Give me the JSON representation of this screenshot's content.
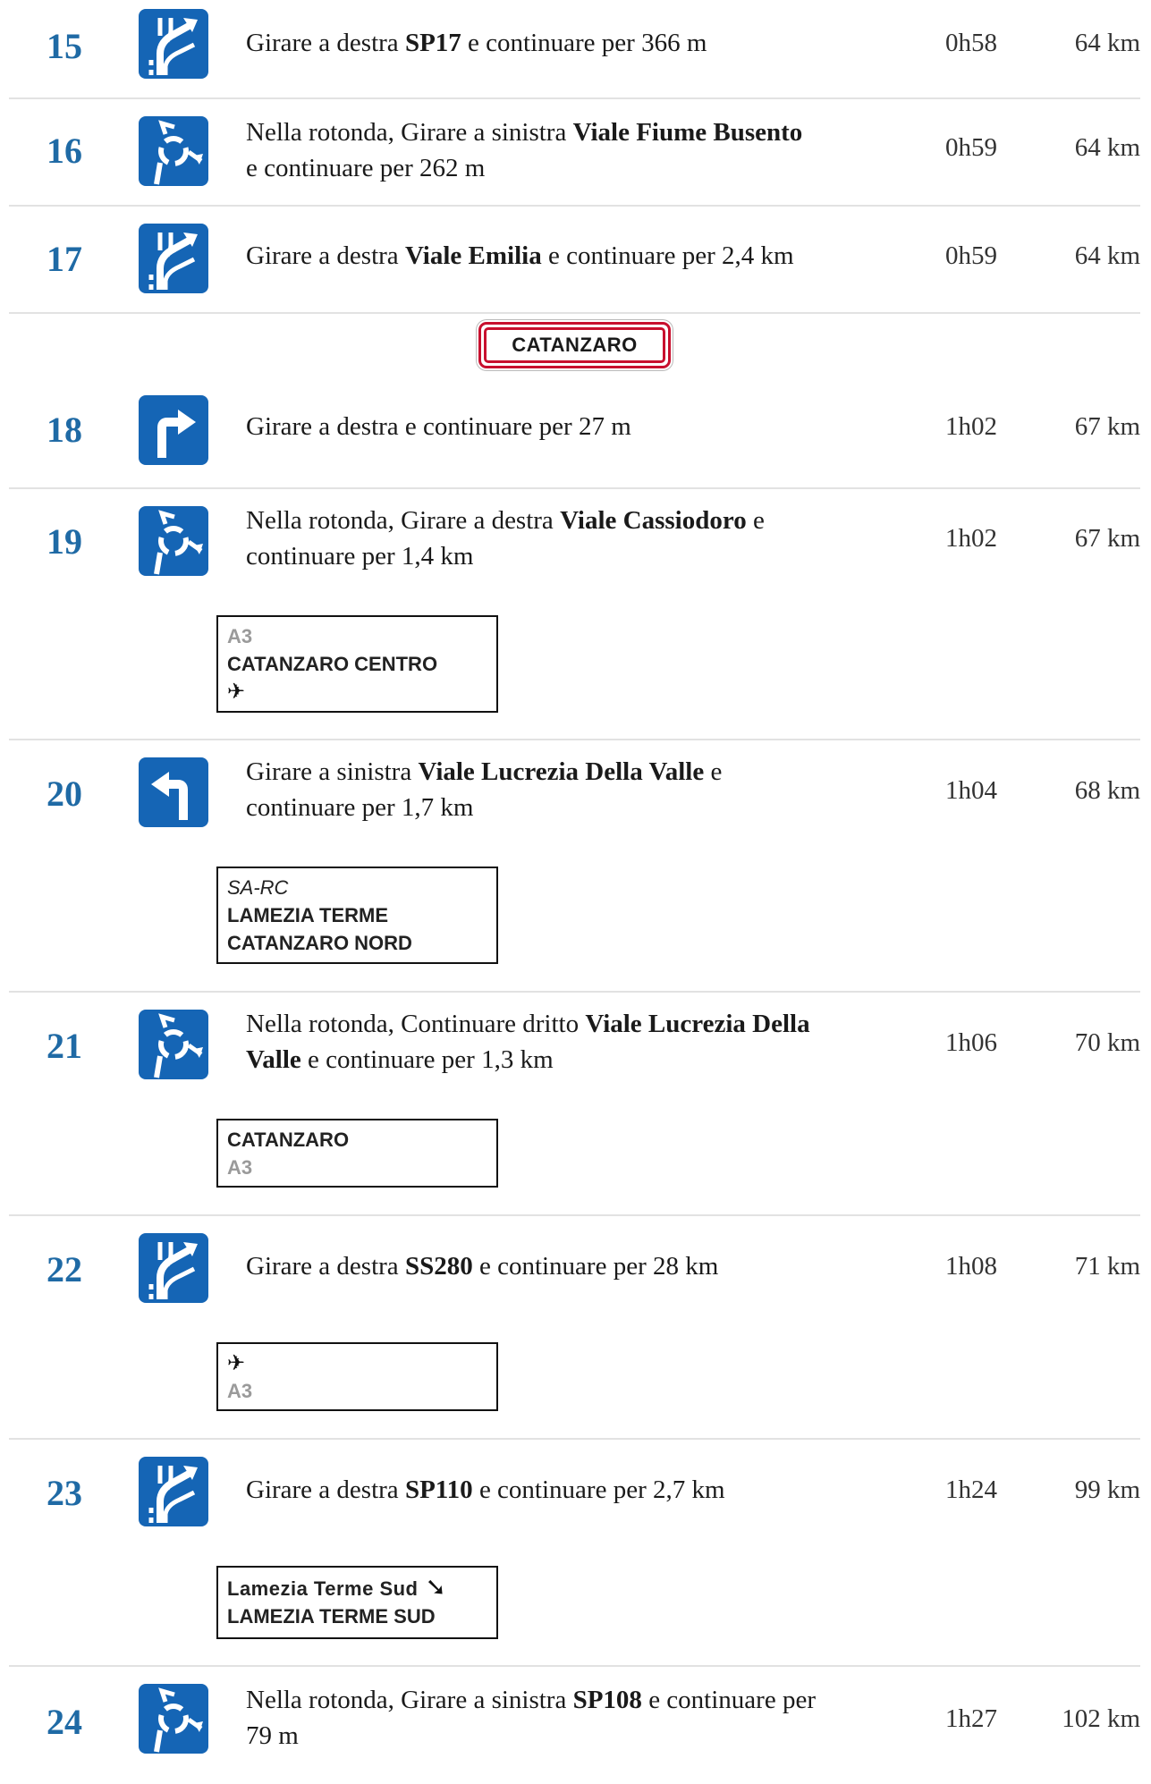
{
  "city_sign": "CATANZARO",
  "steps": [
    {
      "num": "15",
      "maneuver": "bear-right",
      "pre": "Girare a destra ",
      "road": "SP17",
      "post": " e continuare per 366 m",
      "time": "0h58",
      "dist": "64 km"
    },
    {
      "num": "16",
      "maneuver": "roundabout",
      "pre": "Nella rotonda, Girare a sinistra ",
      "road": "Viale Fiume Busento",
      "post": "e continuare per 262 m",
      "time": "0h59",
      "dist": "64 km"
    },
    {
      "num": "17",
      "maneuver": "bear-right",
      "pre": "Girare a destra ",
      "road": "Viale Emilia",
      "post": " e continuare per 2,4 km",
      "time": "0h59",
      "dist": "64 km"
    },
    {
      "num": "18",
      "maneuver": "turn-right",
      "pre": "Girare a destra e continuare per 27 m",
      "road": "",
      "post": "",
      "time": "1h02",
      "dist": "67 km"
    },
    {
      "num": "19",
      "maneuver": "roundabout",
      "pre": "Nella rotonda, Girare a destra ",
      "road": "Viale Cassiodoro",
      "post": " e",
      "post2": "continuare per 1,4 km",
      "time": "1h02",
      "dist": "67 km"
    },
    {
      "num": "20",
      "maneuver": "turn-left",
      "pre": "Girare a sinistra ",
      "road": "Viale Lucrezia Della Valle",
      "post": " e",
      "post2": "continuare per 1,7 km",
      "time": "1h04",
      "dist": "68 km"
    },
    {
      "num": "21",
      "maneuver": "roundabout",
      "pre": "Nella rotonda, Continuare dritto ",
      "road": "Viale Lucrezia Della",
      "road2": "Valle",
      "post": " e continuare per 1,3 km",
      "time": "1h06",
      "dist": "70 km"
    },
    {
      "num": "22",
      "maneuver": "bear-right",
      "pre": "Girare a destra ",
      "road": "SS280",
      "post": " e continuare per 28 km",
      "time": "1h08",
      "dist": "71 km"
    },
    {
      "num": "23",
      "maneuver": "bear-right",
      "pre": "Girare a destra ",
      "road": "SP110",
      "post": " e continuare per 2,7 km",
      "time": "1h24",
      "dist": "99 km"
    },
    {
      "num": "24",
      "maneuver": "roundabout",
      "pre": "Nella rotonda, Girare a sinistra ",
      "road": "SP108",
      "post": " e continuare per",
      "post2": "79 m",
      "time": "1h27",
      "dist": "102 km"
    }
  ],
  "signs": {
    "s19": {
      "road": "A3",
      "dest": "CATANZARO CENTRO",
      "airport_icon": "airplane-icon"
    },
    "s20": {
      "road": "SA-RC",
      "dest1": "LAMEZIA TERME",
      "dest2": "CATANZARO NORD"
    },
    "s21": {
      "dest": "CATANZARO",
      "road": "A3"
    },
    "s22": {
      "airport_icon": "airplane-icon",
      "road": "A3"
    },
    "s23": {
      "exit": "Lamezia Terme Sud",
      "dest": "LAMEZIA TERME SUD",
      "exit_icon": "exit-arrow-icon"
    }
  },
  "colors": {
    "step_number": "#1f6aa5",
    "icon_bg": "#1565b5",
    "city_sign_border": "#c8102e",
    "divider": "#e2e2e2"
  }
}
